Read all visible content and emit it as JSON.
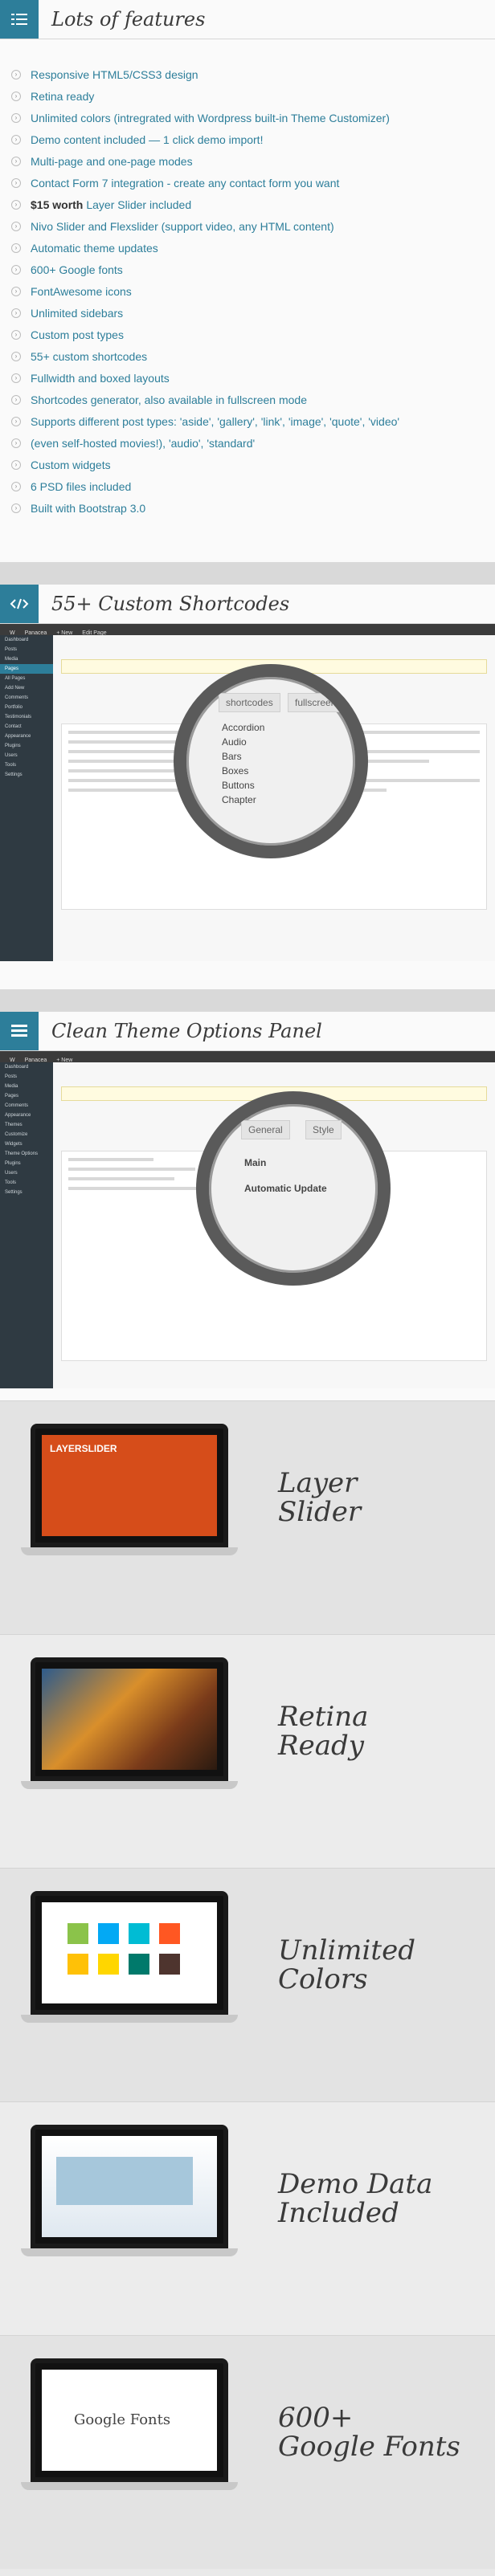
{
  "features_section": {
    "title": "Lots of features",
    "items": [
      {
        "text": "Responsive HTML5/CSS3 design"
      },
      {
        "text": "Retina ready"
      },
      {
        "text": "Unlimited colors (intregrated with Wordpress built-in Theme Customizer)"
      },
      {
        "text": "Demo content included — 1 click demo import!"
      },
      {
        "text": "Multi-page and one-page modes"
      },
      {
        "text": "Contact Form 7 integration - create any contact form you want"
      },
      {
        "text": "Layer Slider included",
        "prefix": "$15 worth"
      },
      {
        "text": "Nivo Slider and Flexslider (support video, any HTML content)"
      },
      {
        "text": "Automatic theme updates"
      },
      {
        "text": "600+ Google fonts"
      },
      {
        "text": "FontAwesome icons"
      },
      {
        "text": "Unlimited sidebars"
      },
      {
        "text": "Custom post types"
      },
      {
        "text": "55+ custom shortcodes"
      },
      {
        "text": "Fullwidth and boxed layouts"
      },
      {
        "text": "Shortcodes generator, also available in fullscreen mode"
      },
      {
        "text": "Supports different post types: 'aside', 'gallery', 'link', 'image', 'quote', 'video'"
      },
      {
        "text": "(even self-hosted movies!), 'audio', 'standard'"
      },
      {
        "text": "Custom widgets"
      },
      {
        "text": "6 PSD files included"
      },
      {
        "text": "Built with Bootstrap 3.0"
      }
    ]
  },
  "shortcodes_section": {
    "title": "55+ Custom Shortcodes",
    "magnifier_tabs": [
      "shortcodes",
      "fullscreen"
    ],
    "magnifier_items": [
      "Accordion",
      "Audio",
      "Bars",
      "Boxes",
      "Buttons",
      "Chapter"
    ]
  },
  "options_section": {
    "title": "Clean Theme Options Panel",
    "magnifier_tabs": [
      "General",
      "Style"
    ],
    "magnifier_items": [
      "Main",
      "Automatic Update"
    ]
  },
  "promos": [
    {
      "title_line1": "Layer",
      "title_line2": "Slider"
    },
    {
      "title_line1": "Retina",
      "title_line2": "Ready"
    },
    {
      "title_line1": "Unlimited",
      "title_line2": "Colors"
    },
    {
      "title_line1": "Demo Data",
      "title_line2": "Included"
    },
    {
      "title_line1": "600+",
      "title_line2": "Google Fonts"
    }
  ],
  "layer_slider_text": "LAYERSLIDER",
  "google_fonts_text": "Google Fonts",
  "colors": {
    "accent": "#2d7e9a",
    "swatches": [
      "#8bc34a",
      "#03a9f4",
      "#00bcd4",
      "#ff5722",
      "#ffc107",
      "#ffd600",
      "#00796b",
      "#4e342e"
    ]
  }
}
